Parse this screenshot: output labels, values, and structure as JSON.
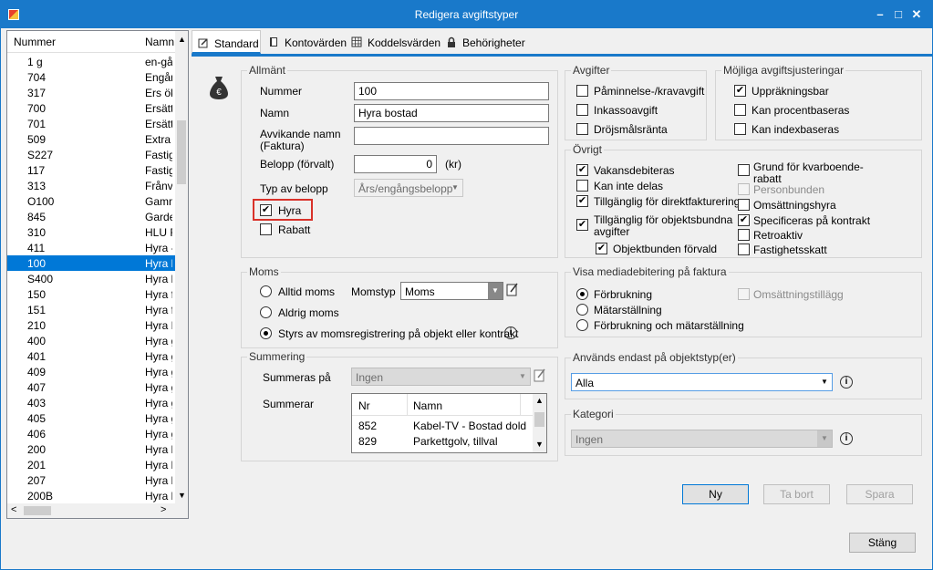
{
  "window": {
    "title": "Redigera avgiftstyper"
  },
  "list": {
    "col_nummer": "Nummer",
    "col_namn": "Namn",
    "rows": [
      {
        "nr": "1 g",
        "namn": "en-gån"
      },
      {
        "nr": "704",
        "namn": "Engån"
      },
      {
        "nr": "317",
        "namn": "Ers ök"
      },
      {
        "nr": "700",
        "namn": "Ersättn"
      },
      {
        "nr": "701",
        "namn": "Ersättn"
      },
      {
        "nr": "509",
        "namn": "Extra"
      },
      {
        "nr": "S227",
        "namn": "Fastig"
      },
      {
        "nr": "117",
        "namn": "Fastig"
      },
      {
        "nr": "313",
        "namn": "Frånva"
      },
      {
        "nr": "O100",
        "namn": "Gamm"
      },
      {
        "nr": "845",
        "namn": "Garde"
      },
      {
        "nr": "310",
        "namn": "HLU F"
      },
      {
        "nr": "411",
        "namn": "Hyra -"
      },
      {
        "nr": "100",
        "namn": "Hyra b"
      },
      {
        "nr": "S400",
        "namn": "Hyra b"
      },
      {
        "nr": "150",
        "namn": "Hyra f"
      },
      {
        "nr": "151",
        "namn": "Hyra f"
      },
      {
        "nr": "210",
        "namn": "Hyra F"
      },
      {
        "nr": "400",
        "namn": "Hyra g"
      },
      {
        "nr": "401",
        "namn": "Hyra g"
      },
      {
        "nr": "409",
        "namn": "Hyra g"
      },
      {
        "nr": "407",
        "namn": "Hyra g"
      },
      {
        "nr": "403",
        "namn": "Hyra g"
      },
      {
        "nr": "405",
        "namn": "Hyra g"
      },
      {
        "nr": "406",
        "namn": "Hyra g"
      },
      {
        "nr": "200",
        "namn": "Hyra l"
      },
      {
        "nr": "201",
        "namn": "Hyra l"
      },
      {
        "nr": "207",
        "namn": "Hyra l"
      },
      {
        "nr": "200B",
        "namn": "Hyra l"
      }
    ]
  },
  "tabs": [
    "Standard",
    "Kontovärden",
    "Koddelsvärden",
    "Behörigheter"
  ],
  "allmant": {
    "title": "Allmänt",
    "nummer_label": "Nummer",
    "nummer_value": "100",
    "namn_label": "Namn",
    "namn_value": "Hyra bostad",
    "avvikande_label1": "Avvikande namn",
    "avvikande_label2": "(Faktura)",
    "avvikande_value": "",
    "belopp_label": "Belopp (förvalt)",
    "belopp_value": "0",
    "belopp_unit": "(kr)",
    "typ_label": "Typ av belopp",
    "typ_value": "Års/engångsbelopp",
    "hyra_label": "Hyra",
    "rabatt_label": "Rabatt"
  },
  "avgifter": {
    "title": "Avgifter",
    "items": [
      "Påminnelse-/kravavgift",
      "Inkassoavgift",
      "Dröjsmålsränta"
    ]
  },
  "justeringar": {
    "title": "Möjliga avgiftsjusteringar",
    "items": [
      "Uppräkningsbar",
      "Kan procentbaseras",
      "Kan indexbaseras"
    ]
  },
  "ovrigt": {
    "title": "Övrigt",
    "vakans": "Vakansdebiteras",
    "kan_inte": "Kan inte delas",
    "direkt": "Tillgänglig för direktfakturering",
    "objekt1": "Tillgänglig för objektsbundna",
    "objekt2": "avgifter",
    "objektbunden": "Objektbunden förvald",
    "grund1": "Grund för kvarboende-",
    "grund2": "rabatt",
    "personbunden": "Personbunden",
    "omsattningshyra": "Omsättningshyra",
    "specificeras": "Specificeras på kontrakt",
    "retroaktiv": "Retroaktiv",
    "fastighetsskatt": "Fastighetsskatt"
  },
  "moms": {
    "title": "Moms",
    "alltid": "Alltid moms",
    "aldrig": "Aldrig moms",
    "styrs": "Styrs av momsregistrering på objekt eller kontrakt",
    "momstyp_label": "Momstyp",
    "momstyp_value": "Moms"
  },
  "media": {
    "title": "Visa mediadebitering på faktura",
    "forbrukning": "Förbrukning",
    "matarstallning": "Mätarställning",
    "both": "Förbrukning och mätarställning",
    "omsattningstillagg": "Omsättningstillägg"
  },
  "summering": {
    "title": "Summering",
    "summeras_label": "Summeras på",
    "summeras_value": "Ingen",
    "summerar_label": "Summerar",
    "col_nr": "Nr",
    "col_namn": "Namn",
    "rows": [
      {
        "nr": "852",
        "namn": "Kabel-TV - Bostad dold"
      },
      {
        "nr": "829",
        "namn": "Parkettgolv, tillval"
      }
    ]
  },
  "objektstyp": {
    "title": "Används endast på objektstyp(er)",
    "value": "Alla"
  },
  "kategori": {
    "title": "Kategori",
    "value": "Ingen"
  },
  "buttons": {
    "ny": "Ny",
    "ta_bort": "Ta bort",
    "spara": "Spara",
    "stang": "Stäng"
  },
  "colors": {
    "accent": "#1979ca",
    "selection": "#0078d7",
    "highlight": "#d9322a"
  }
}
